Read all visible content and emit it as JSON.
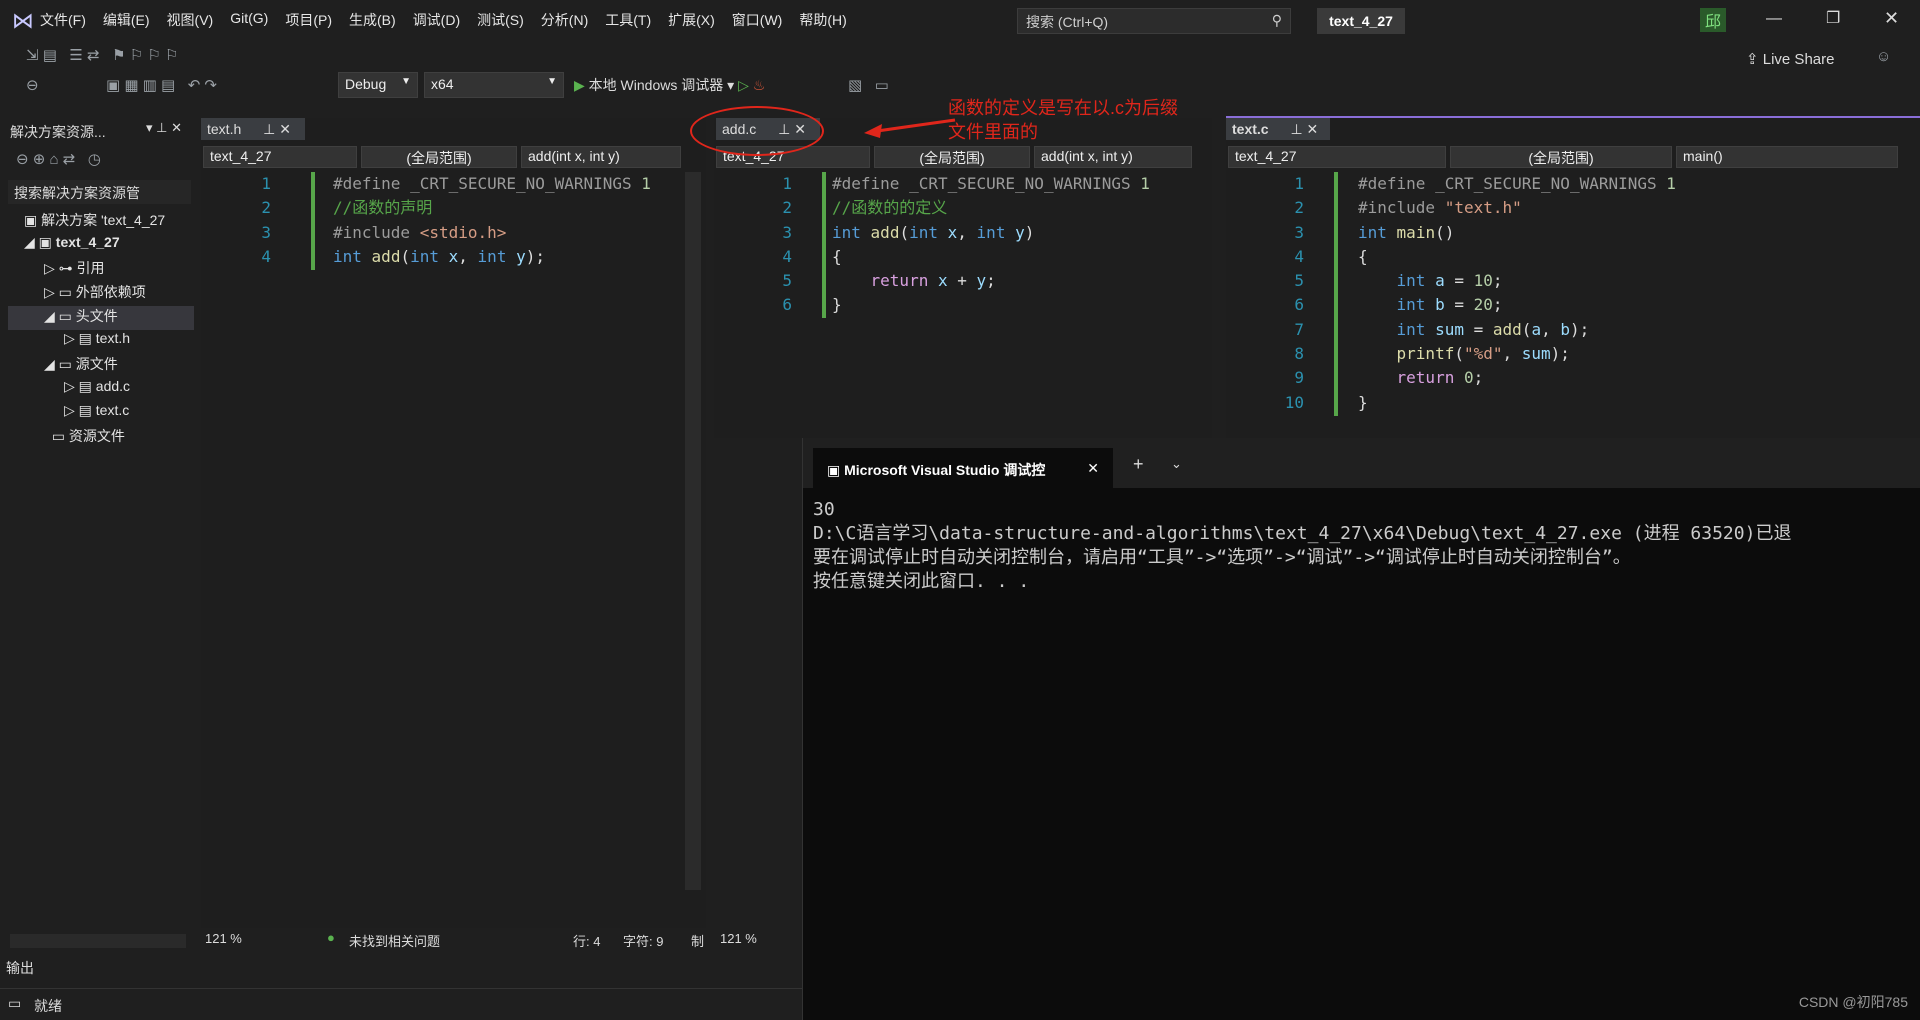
{
  "menu": [
    "文件(F)",
    "编辑(E)",
    "视图(V)",
    "Git(G)",
    "项目(P)",
    "生成(B)",
    "调试(D)",
    "测试(S)",
    "分析(N)",
    "工具(T)",
    "扩展(X)",
    "窗口(W)",
    "帮助(H)"
  ],
  "search": "搜索 (Ctrl+Q)",
  "solution_title": "text_4_27",
  "user_initial": "邱",
  "live_share": "Live Share",
  "config": "Debug",
  "platform": "x64",
  "run_label": "本地 Windows 调试器",
  "solution_explorer": {
    "title": "解决方案资源...",
    "search": "搜索解决方案资源管",
    "items": [
      "解决方案 'text_4_27",
      "text_4_27",
      "引用",
      "外部依赖项",
      "头文件",
      "text.h",
      "源文件",
      "add.c",
      "text.c",
      "资源文件"
    ]
  },
  "annotation": {
    "line1": "函数的定义是写在以.c为后缀",
    "line2": "文件里面的"
  },
  "editors": [
    {
      "tab": "text.h",
      "project": "text_4_27",
      "scope": "(全局范围)",
      "member": "add(int x, int y)"
    },
    {
      "tab": "add.c",
      "project": "text_4_27",
      "scope": "(全局范围)",
      "member": "add(int x, int y)"
    },
    {
      "tab": "text.c",
      "project": "text_4_27",
      "scope": "(全局范围)",
      "member": "main()"
    }
  ],
  "status": {
    "zoom": "121 %",
    "issues": "未找到相关问题",
    "line": "行: 4",
    "char": "字符: 9",
    "mode": "制",
    "zoom2": "121 %",
    "output": "输出",
    "ready": "就绪"
  },
  "console": {
    "tab": "Microsoft Visual Studio 调试控",
    "output": "30\nD:\\C语言学习\\data-structure-and-algorithms\\text_4_27\\x64\\Debug\\text_4_27.exe (进程 63520)已退\n要在调试停止时自动关闭控制台，请启用“工具”->“选项”->“调试”->“调试停止时自动关闭控制台”。\n按任意键关闭此窗口. . .",
    "watermark": "CSDN @初阳785"
  },
  "colors": {
    "accent": "#007acc",
    "annotation": "#e0261b"
  }
}
